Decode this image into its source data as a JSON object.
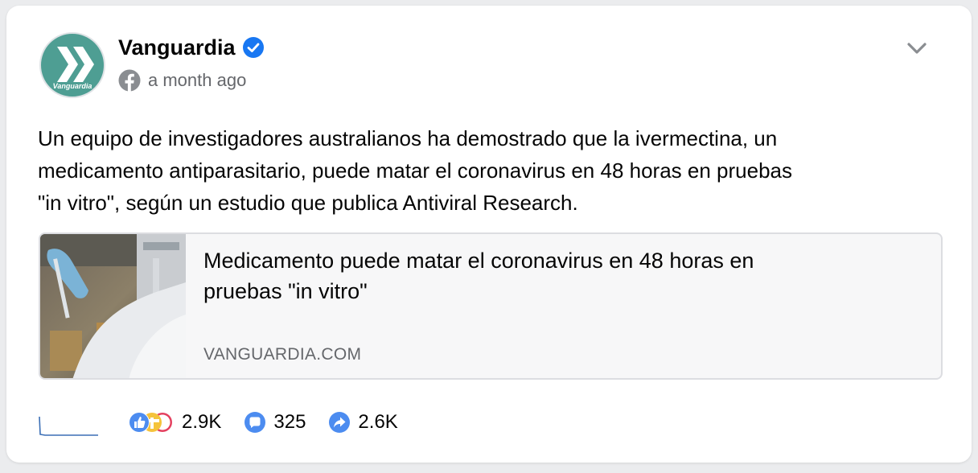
{
  "post": {
    "page_name": "Vanguardia",
    "avatar_label": "Vanguardia",
    "timestamp": "a month ago",
    "text_lines": [
      "Un equipo de investigadores australianos ha demostrado que la ivermectina, un",
      "medicamento antiparasitario, puede matar el coronavirus en 48 horas en pruebas",
      "\"in vitro\", según un estudio que publica Antiviral Research."
    ]
  },
  "link": {
    "title_lines": [
      "Medicamento puede matar el coronavirus en 48 horas en",
      "pruebas \"in vitro\""
    ],
    "domain": "VANGUARDIA.COM"
  },
  "stats": {
    "reactions": "2.9K",
    "comments": "325",
    "shares": "2.6K"
  },
  "icons": {
    "verified": "verified-badge-icon",
    "source": "facebook-icon",
    "menu": "chevron-down-icon",
    "reactions": "reactions-icon",
    "comments": "comment-icon",
    "shares": "share-icon"
  },
  "colors": {
    "brand": "#4e9e93",
    "verified": "#1877f2",
    "link_card_bg": "#f7f7f8",
    "secondary_text": "#65676b"
  }
}
